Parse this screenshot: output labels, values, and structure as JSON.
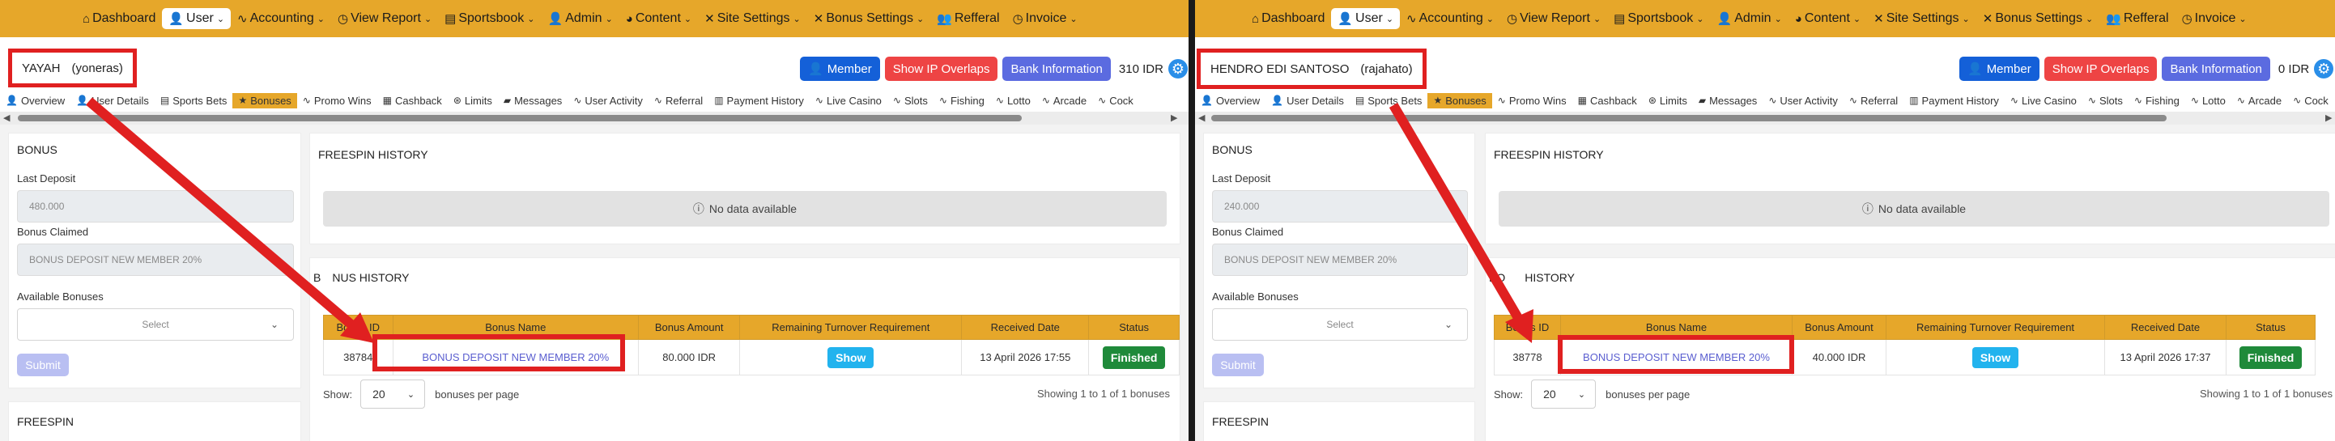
{
  "nav": {
    "items": [
      {
        "icon": "home-icon",
        "glyph": "⌂",
        "label": "Dashboard",
        "chevron": false
      },
      {
        "icon": "user-icon",
        "glyph": "👤",
        "label": "User",
        "chevron": true,
        "active": true
      },
      {
        "icon": "activity-icon",
        "glyph": "∿",
        "label": "Accounting",
        "chevron": true
      },
      {
        "icon": "clock-icon",
        "glyph": "◷",
        "label": "View Report",
        "chevron": true
      },
      {
        "icon": "book-icon",
        "glyph": "▤",
        "label": "Sportsbook",
        "chevron": true
      },
      {
        "icon": "user-icon",
        "glyph": "👤",
        "label": "Admin",
        "chevron": true
      },
      {
        "icon": "palette-icon",
        "glyph": "◕",
        "label": "Content",
        "chevron": true
      },
      {
        "icon": "crossed-tools-icon",
        "glyph": "✕",
        "label": "Site Settings",
        "chevron": true
      },
      {
        "icon": "crossed-tools-icon",
        "glyph": "✕",
        "label": "Bonus Settings",
        "chevron": true
      },
      {
        "icon": "users-icon",
        "glyph": "👥",
        "label": "Refferal",
        "chevron": false
      },
      {
        "icon": "clock-icon",
        "glyph": "◷",
        "label": "Invoice",
        "chevron": true
      }
    ]
  },
  "buttons": {
    "member": "Member",
    "ip": "Show IP Overlaps",
    "bank": "Bank Information"
  },
  "tabs": [
    {
      "icon": "user-icon",
      "glyph": "👤",
      "label": "Overview"
    },
    {
      "icon": "user-icon",
      "glyph": "👤",
      "label": "User Details"
    },
    {
      "icon": "book-icon",
      "glyph": "▤",
      "label": "Sports Bets"
    },
    {
      "icon": "star-icon",
      "glyph": "★",
      "label": "Bonuses",
      "active": true
    },
    {
      "icon": "activity-icon",
      "glyph": "∿",
      "label": "Promo Wins"
    },
    {
      "icon": "cashback-icon",
      "glyph": "▦",
      "label": "Cashback"
    },
    {
      "icon": "limits-icon",
      "glyph": "⊛",
      "label": "Limits"
    },
    {
      "icon": "messages-icon",
      "glyph": "▰",
      "label": "Messages"
    },
    {
      "icon": "activity-icon",
      "glyph": "∿",
      "label": "User Activity"
    },
    {
      "icon": "activity-icon",
      "glyph": "∿",
      "label": "Referral"
    },
    {
      "icon": "chart-icon",
      "glyph": "▥",
      "label": "Payment History"
    },
    {
      "icon": "activity-icon",
      "glyph": "∿",
      "label": "Live Casino"
    },
    {
      "icon": "activity-icon",
      "glyph": "∿",
      "label": "Slots"
    },
    {
      "icon": "activity-icon",
      "glyph": "∿",
      "label": "Fishing"
    },
    {
      "icon": "activity-icon",
      "glyph": "∿",
      "label": "Lotto"
    },
    {
      "icon": "activity-icon",
      "glyph": "∿",
      "label": "Arcade"
    },
    {
      "icon": "activity-icon",
      "glyph": "∿",
      "label": "Cock"
    }
  ],
  "bonus_panel": {
    "title": "BONUS",
    "last_deposit_label": "Last Deposit",
    "bonus_claimed_label": "Bonus Claimed",
    "available_bonuses_label": "Available Bonuses",
    "select_placeholder": "Select",
    "submit": "Submit"
  },
  "freespin_panel_title": "FREESPIN",
  "freespin_history": {
    "title": "FREESPIN HISTORY",
    "no_data": "No data available"
  },
  "bonus_history": {
    "title_visible": "B",
    "title_visible_tail": "NUS HISTORY",
    "columns": [
      "Bonus ID",
      "Bonus Name",
      "Bonus Amount",
      "Remaining Turnover Requirement",
      "Received Date",
      "Status"
    ],
    "show_label": "Show",
    "status_label": "Finished",
    "footer_show": "Show:",
    "per_page": "20",
    "per_page_suffix": "bonuses per page",
    "showing": "Showing 1 to 1 of 1 bonuses"
  },
  "panes": [
    {
      "user": {
        "name": "YAYAH",
        "username": "(yoneras)"
      },
      "balance": "310 IDR",
      "last_deposit": "480.000",
      "bonus_claimed": "BONUS DEPOSIT NEW MEMBER 20%",
      "bonus_title_visible": "B",
      "bonus_title_tail": "NUS HISTORY",
      "row": {
        "id": "38784",
        "name": "BONUS DEPOSIT NEW MEMBER 20%",
        "amount": "80.000 IDR",
        "date": "13 April 2026 17:55"
      }
    },
    {
      "user": {
        "name": "HENDRO EDI SANTOSO",
        "username": "(rajahato)"
      },
      "balance": "0 IDR",
      "last_deposit": "240.000",
      "bonus_claimed": "BONUS DEPOSIT NEW MEMBER 20%",
      "bonus_title_visible": "BO",
      "bonus_title_tail": "HISTORY",
      "row": {
        "id": "38778",
        "name": "BONUS DEPOSIT NEW MEMBER 20%",
        "amount": "40.000 IDR",
        "date": "13 April 2026 17:37"
      }
    }
  ],
  "colors": {
    "nav_bar": "#e6a72a",
    "highlight": "#e02020",
    "show_badge": "#22b3ee",
    "finished_badge": "#1f8a3a"
  }
}
